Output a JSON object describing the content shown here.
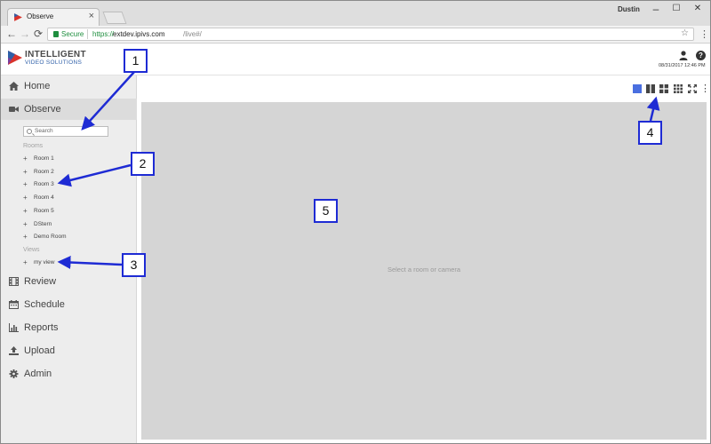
{
  "browser": {
    "tab_title": "Observe",
    "tab_close": "×",
    "profile_name": "Dustin",
    "window_controls": {
      "minimize": "–",
      "maximize": "☐",
      "close": "✕"
    },
    "nav": {
      "back": "←",
      "forward": "→",
      "reload": "⟳"
    },
    "secure_label": "Secure",
    "url_protocol": "https://",
    "url_host": "extdev.ipivs.com",
    "url_path": "/live#/",
    "bookmark_star": "☆",
    "menu_kebab": "⋮"
  },
  "app": {
    "logo_line1": "INTELLIGENT",
    "logo_line2": "VIDEO SOLUTIONS",
    "help_icon_glyph": "?",
    "datetime": "08/31/2017 12:46 PM",
    "accent_color": "#4a6fe0",
    "callout_color": "#1e2bd4"
  },
  "sidebar": {
    "items": [
      {
        "label": "Home",
        "icon": "home-icon"
      },
      {
        "label": "Observe",
        "icon": "video-camera-icon",
        "active": true
      },
      {
        "label": "Review",
        "icon": "film-icon"
      },
      {
        "label": "Schedule",
        "icon": "calendar-icon"
      },
      {
        "label": "Reports",
        "icon": "bar-chart-icon"
      },
      {
        "label": "Upload",
        "icon": "upload-icon"
      },
      {
        "label": "Admin",
        "icon": "gear-icon"
      }
    ],
    "search_placeholder": "Search",
    "rooms_label": "Rooms",
    "rooms": [
      "Room 1",
      "Room 2",
      "Room 3",
      "Room 4",
      "Room 5",
      "DStern",
      "Demo Room"
    ],
    "views_label": "Views",
    "views": [
      "my view"
    ],
    "plus_glyph": "+"
  },
  "main": {
    "layout_buttons": [
      "single-layout-icon",
      "two-column-layout-icon",
      "quad-layout-icon",
      "nine-grid-layout-icon",
      "fullscreen-icon",
      "more-options-icon"
    ],
    "more_glyph": "⋮",
    "empty_message": "Select a room or camera"
  },
  "callouts": [
    "1",
    "2",
    "3",
    "4",
    "5"
  ]
}
